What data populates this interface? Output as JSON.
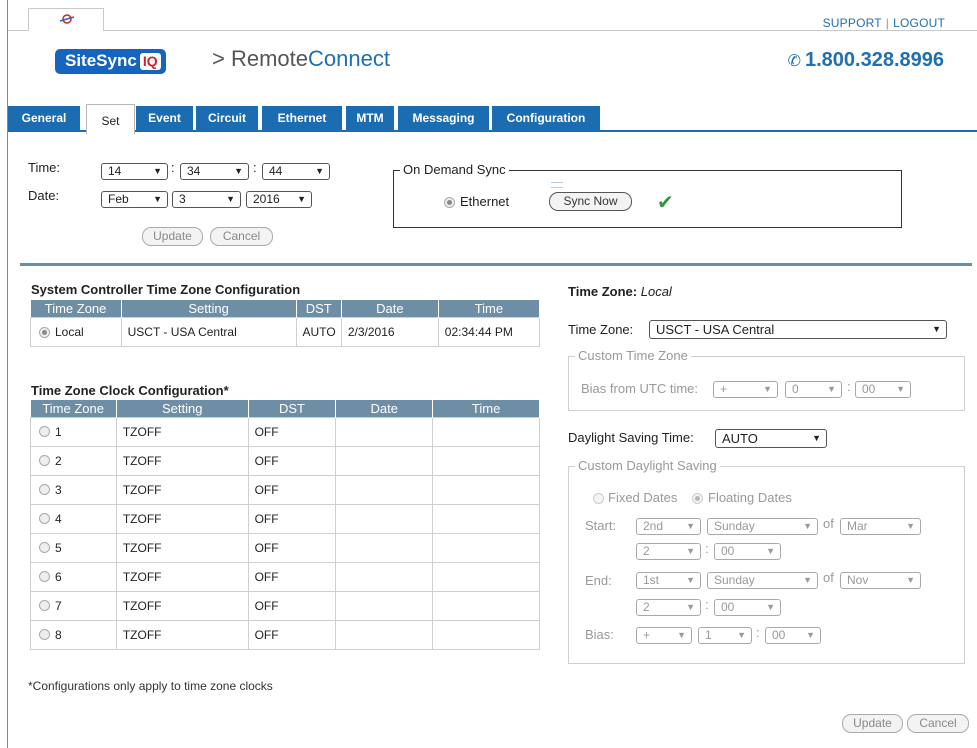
{
  "topbar": {
    "support": "SUPPORT",
    "separator": "|",
    "logout": "LOGOUT"
  },
  "header": {
    "logo_text": "SiteSync",
    "logo_iq": "IQ",
    "title_prefix": "> Remote",
    "title_accent": "Connect",
    "phone": "1.800.328.8996"
  },
  "tabs": [
    "General",
    "Set",
    "Event",
    "Circuit",
    "Ethernet",
    "MTM",
    "Messaging",
    "Configuration"
  ],
  "active_tab": "Set",
  "time_form": {
    "time_label": "Time:",
    "date_label": "Date:",
    "hour": "14",
    "minute": "34",
    "second": "44",
    "month": "Feb",
    "day": "3",
    "year": "2016",
    "colon": ":",
    "update": "Update",
    "cancel": "Cancel"
  },
  "on_demand": {
    "legend": "On Demand Sync",
    "ethernet": "Ethernet",
    "sync_now": "Sync Now",
    "status_icon": "check-icon"
  },
  "sc_table": {
    "title": "System Controller Time Zone Configuration",
    "headers": [
      "Time Zone",
      "Setting",
      "DST",
      "Date",
      "Time"
    ],
    "row": {
      "zone": "Local",
      "setting": "USCT - USA Central",
      "dst": "AUTO",
      "date": "2/3/2016",
      "time": "02:34:44 PM"
    }
  },
  "tz_table": {
    "title": "Time Zone Clock Configuration*",
    "headers": [
      "Time Zone",
      "Setting",
      "DST",
      "Date",
      "Time"
    ],
    "rows": [
      {
        "zone": "1",
        "setting": "TZOFF",
        "dst": "OFF"
      },
      {
        "zone": "2",
        "setting": "TZOFF",
        "dst": "OFF"
      },
      {
        "zone": "3",
        "setting": "TZOFF",
        "dst": "OFF"
      },
      {
        "zone": "4",
        "setting": "TZOFF",
        "dst": "OFF"
      },
      {
        "zone": "5",
        "setting": "TZOFF",
        "dst": "OFF"
      },
      {
        "zone": "6",
        "setting": "TZOFF",
        "dst": "OFF"
      },
      {
        "zone": "7",
        "setting": "TZOFF",
        "dst": "OFF"
      },
      {
        "zone": "8",
        "setting": "TZOFF",
        "dst": "OFF"
      }
    ]
  },
  "footnote": "*Configurations only apply to time zone clocks",
  "right_panel": {
    "tz_heading": "Time Zone:",
    "tz_heading_value": "Local",
    "tz_label": "Time Zone:",
    "tz_value": "USCT - USA Central",
    "custom_tz_legend": "Custom Time Zone",
    "bias_label": "Bias from UTC time:",
    "bias_sign": "+",
    "bias_hour": "0",
    "bias_min": "00",
    "dst_label": "Daylight Saving Time:",
    "dst_value": "AUTO",
    "custom_dst_legend": "Custom Daylight Saving",
    "fixed_dates": "Fixed Dates",
    "floating_dates": "Floating Dates",
    "start_label": "Start:",
    "end_label": "End:",
    "bias2_label": "Bias:",
    "of": "of",
    "start": {
      "week": "2nd",
      "day": "Sunday",
      "month": "Mar",
      "hour": "2",
      "min": "00"
    },
    "end": {
      "week": "1st",
      "day": "Sunday",
      "month": "Nov",
      "hour": "2",
      "min": "00"
    },
    "bias2": {
      "sign": "+",
      "hour": "1",
      "min": "00"
    },
    "update": "Update",
    "cancel": "Cancel"
  }
}
